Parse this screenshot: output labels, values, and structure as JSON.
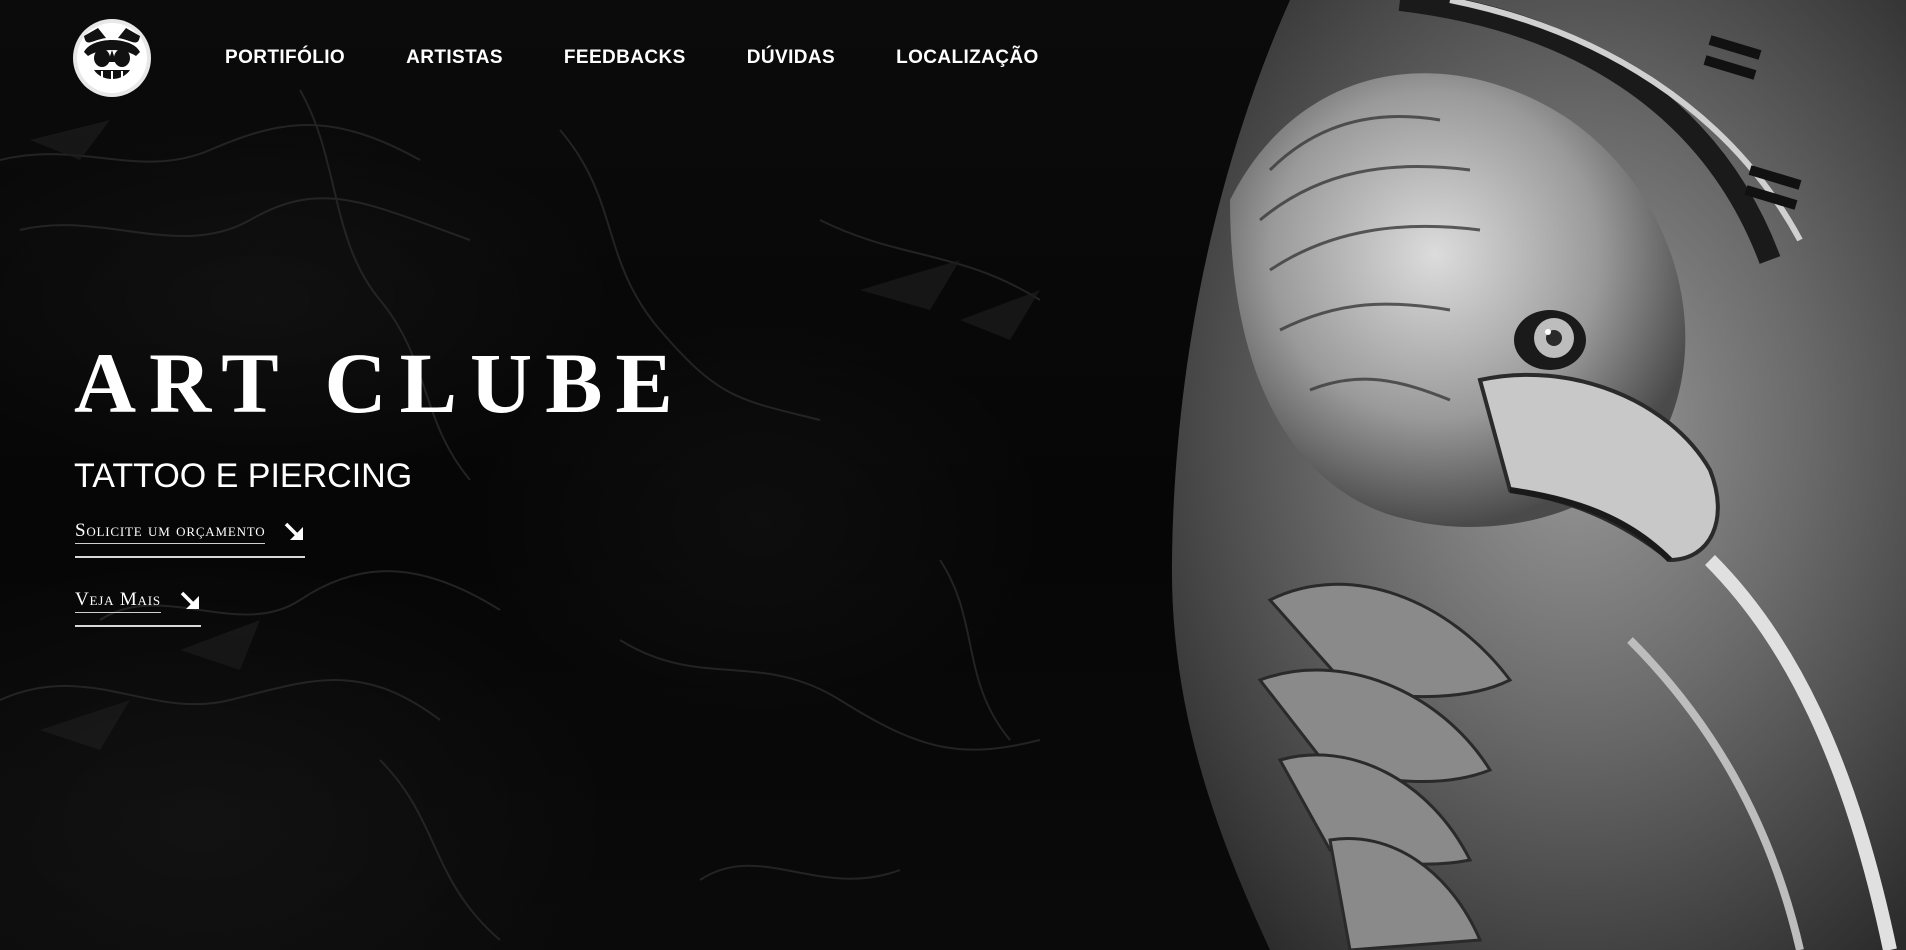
{
  "logo": {
    "icon": "cartoon-mascot-logo-icon"
  },
  "nav": {
    "items": [
      {
        "label": "PORTIFÓLIO"
      },
      {
        "label": "ARTISTAS"
      },
      {
        "label": "FEEDBACKS"
      },
      {
        "label": "DÚVIDAS"
      },
      {
        "label": "LOCALIZAÇÃO"
      }
    ]
  },
  "hero": {
    "title": "ART CLUBE",
    "subtitle": "TATTOO E PIERCING",
    "cta_primary": {
      "label": "Solicite um orçamento",
      "icon": "arrow-down-right-icon"
    },
    "cta_secondary": {
      "label": "Veja Mais",
      "icon": "arrow-down-right-icon"
    },
    "image": "eagle-tattoo-image"
  },
  "colors": {
    "background": "#050505",
    "text": "#ffffff",
    "accent_line": "#d8d8d8"
  }
}
